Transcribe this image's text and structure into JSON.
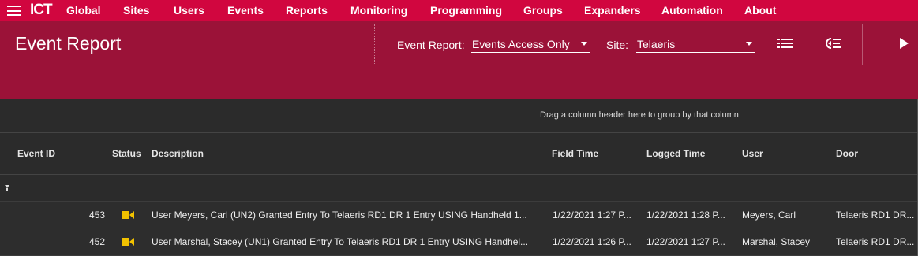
{
  "app": {
    "logo": "ICT"
  },
  "menu": {
    "items": [
      "Global",
      "Sites",
      "Users",
      "Events",
      "Reports",
      "Monitoring",
      "Programming",
      "Groups",
      "Expanders",
      "Automation",
      "About"
    ]
  },
  "header": {
    "title": "Event Report",
    "report_label": "Event Report:",
    "report_value": "Events Access Only",
    "site_label": "Site:",
    "site_value": "Telaeris"
  },
  "grid": {
    "group_hint": "Drag a column header here to group by that column",
    "columns": [
      "Event ID",
      "Status",
      "Description",
      "Field Time",
      "Logged Time",
      "User",
      "Door"
    ],
    "rows": [
      {
        "event_id": "453",
        "status_icon": "camera-icon",
        "description": "User Meyers, Carl (UN2) Granted Entry To Telaeris RD1 DR 1 Entry USING Handheld 1...",
        "field_time": "1/22/2021 1:27 P...",
        "logged_time": "1/22/2021 1:28 P...",
        "user": "Meyers, Carl",
        "door": "Telaeris RD1 DR..."
      },
      {
        "event_id": "452",
        "status_icon": "camera-icon",
        "description": "User Marshal, Stacey (UN1) Granted Entry To Telaeris RD1 DR 1 Entry USING Handhel...",
        "field_time": "1/22/2021 1:26 P...",
        "logged_time": "1/22/2021 1:27 P...",
        "user": "Marshal, Stacey",
        "door": "Telaeris RD1 DR..."
      }
    ]
  },
  "colors": {
    "menu_bg": "#d1063f",
    "header_bg": "#9b1238",
    "grid_bg": "#2d2d2d",
    "status_icon": "#f2c200"
  }
}
